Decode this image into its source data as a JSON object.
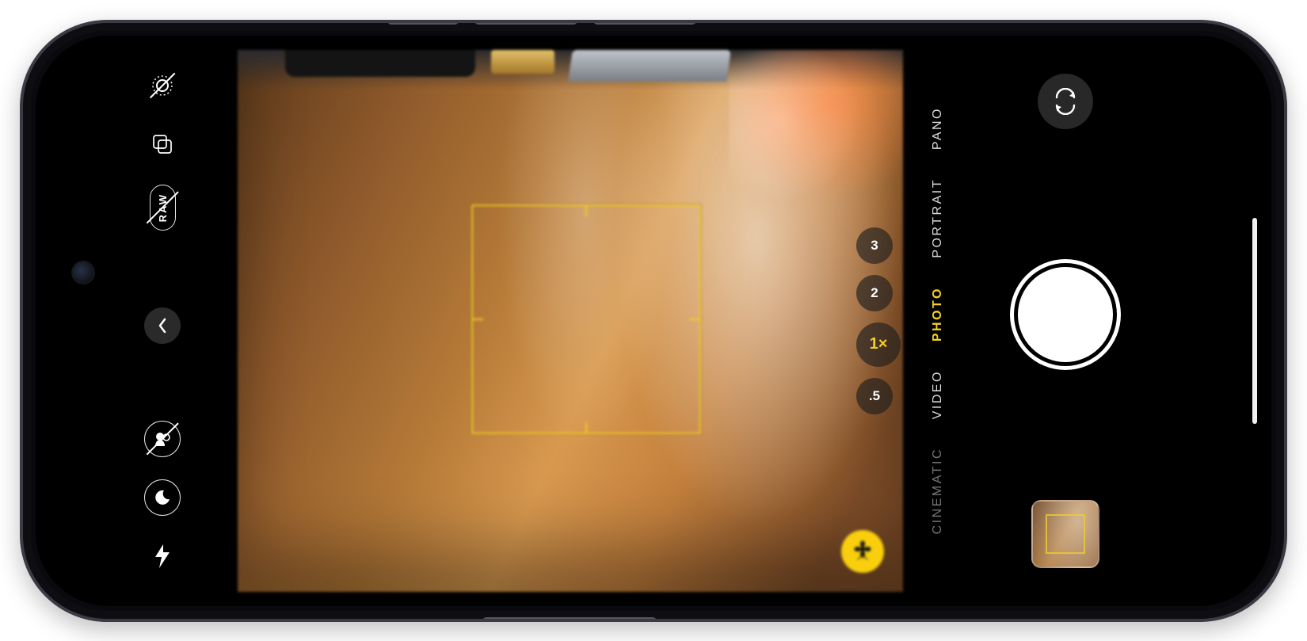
{
  "device": "iPhone (landscape)",
  "app": "Camera",
  "colors": {
    "accent": "#f5cf1e",
    "focus": "#efca34"
  },
  "left_controls": {
    "live_photo": {
      "name": "live-photo-off-icon",
      "state": "off"
    },
    "styles": {
      "name": "photographic-styles-icon",
      "state": "on"
    },
    "raw": {
      "label": "RAW",
      "state": "off"
    },
    "back": {
      "name": "chevron-left-icon"
    },
    "depth": {
      "name": "depth-off-icon",
      "state": "off"
    },
    "night": {
      "name": "night-mode-icon",
      "state": "auto"
    },
    "flash": {
      "name": "flash-auto-icon",
      "state": "auto"
    }
  },
  "viewfinder": {
    "focus_state": "locked",
    "macro_mode": true,
    "macro_icon": "flower-icon"
  },
  "zoom": {
    "options": [
      "3",
      "2",
      "1×",
      ".5"
    ],
    "active_index": 2
  },
  "modes": {
    "items": [
      "CINEMATIC",
      "VIDEO",
      "PHOTO",
      "PORTRAIT",
      "PANO"
    ],
    "active_index": 2
  },
  "right_controls": {
    "flip": "flip-camera-icon",
    "shutter": "shutter-button",
    "thumbnail": "last-photo-thumbnail"
  }
}
